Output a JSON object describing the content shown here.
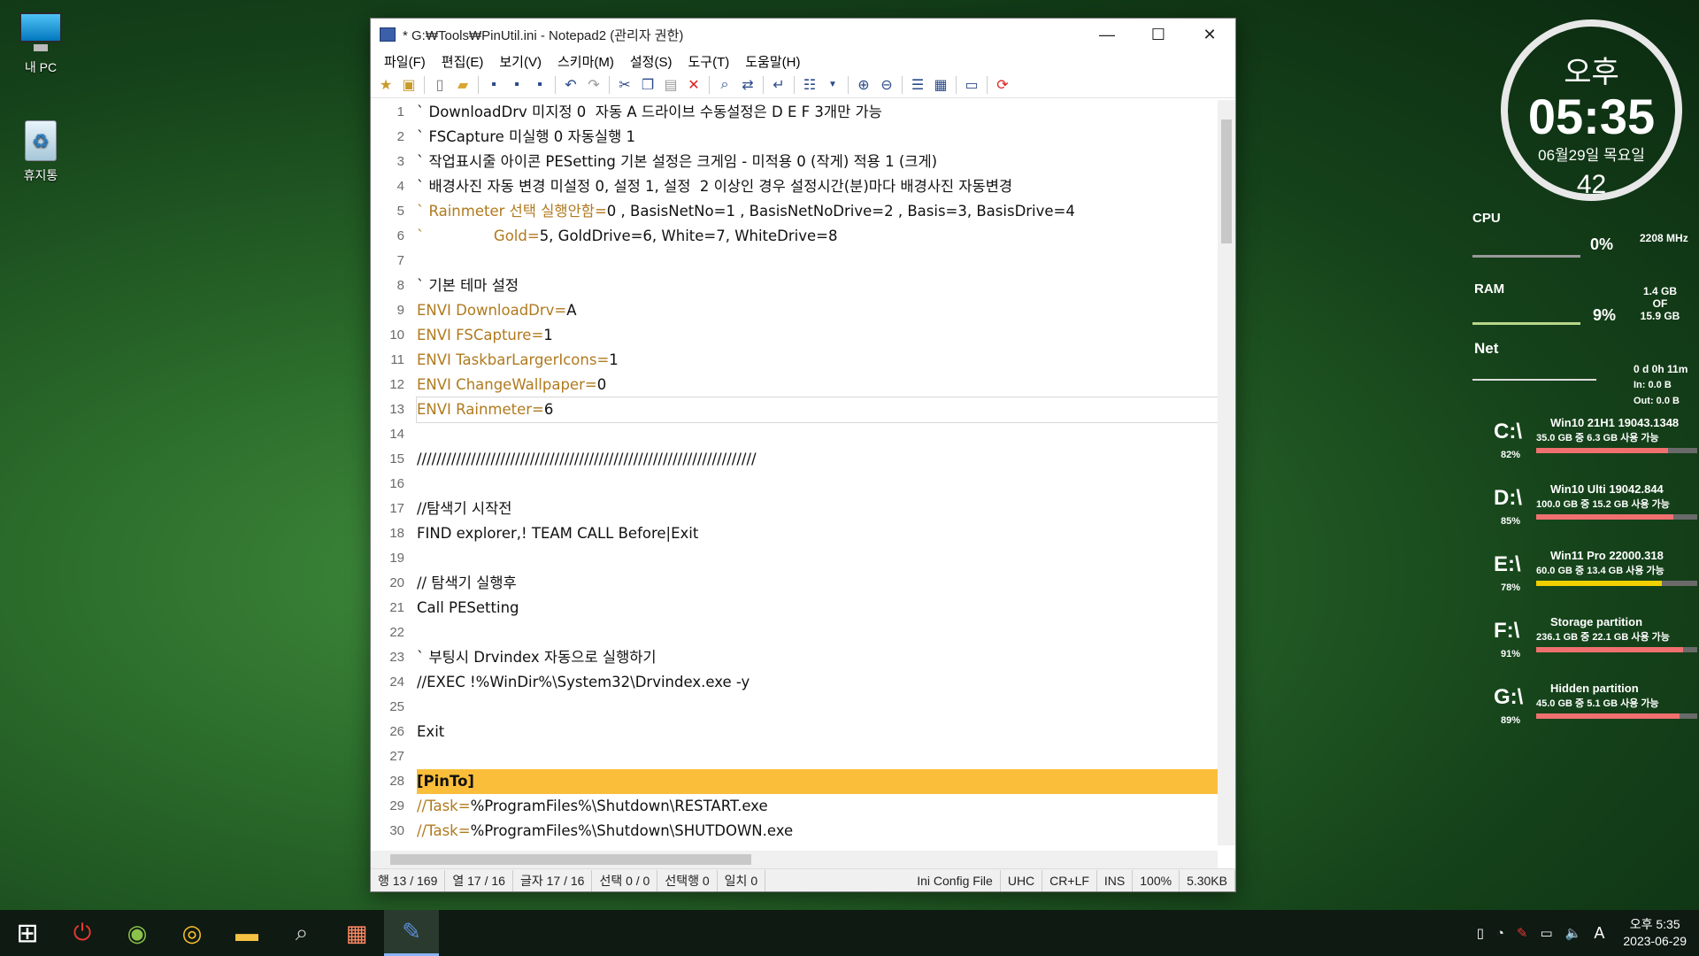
{
  "desktop": {
    "icons": [
      {
        "label": "내 PC"
      },
      {
        "label": "휴지통"
      }
    ]
  },
  "window": {
    "title": "* G:₩Tools₩PinUtil.ini - Notepad2 (관리자 권한)",
    "menu": [
      "파일(F)",
      "편집(E)",
      "보기(V)",
      "스키마(M)",
      "설정(S)",
      "도구(T)",
      "도움말(H)"
    ],
    "lines": [
      {
        "n": "1",
        "t": "` DownloadDrv 미지정 0  자동 A 드라이브 수동설정은 D E F 3개만 가능",
        "k": ""
      },
      {
        "n": "2",
        "t": "` FSCapture 미실행 0 자동실행 1",
        "k": ""
      },
      {
        "n": "3",
        "t": "` 작업표시줄 아이콘 PESetting 기본 설정은 크게임 - 미적용 0 (작게) 적용 1 (크게)",
        "k": ""
      },
      {
        "n": "4",
        "t": "` 배경사진 자동 변경 미설정 0, 설정 1, 설정  2 이상인 경우 설정시간(분)마다 배경사진 자동변경",
        "k": ""
      },
      {
        "n": "5",
        "t": "0 , BasisNetNo=1 , BasisNetNoDrive=2 , Basis=3, BasisDrive=4",
        "k": "` Rainmeter 선택 실행안함="
      },
      {
        "n": "6",
        "t": "5, GoldDrive=6, White=7, WhiteDrive=8",
        "k": "`               Gold="
      },
      {
        "n": "7",
        "t": "",
        "k": ""
      },
      {
        "n": "8",
        "t": "` 기본 테마 설정",
        "k": ""
      },
      {
        "n": "9",
        "t": "A",
        "k": "ENVI DownloadDrv="
      },
      {
        "n": "10",
        "t": "1",
        "k": "ENVI FSCapture="
      },
      {
        "n": "11",
        "t": "1",
        "k": "ENVI TaskbarLargerIcons="
      },
      {
        "n": "12",
        "t": "0",
        "k": "ENVI ChangeWallpaper="
      },
      {
        "n": "13",
        "t": "6",
        "k": "ENVI Rainmeter="
      },
      {
        "n": "14",
        "t": "",
        "k": ""
      },
      {
        "n": "15",
        "t": "/////////////////////////////////////////////////////////////////////",
        "k": ""
      },
      {
        "n": "16",
        "t": "",
        "k": ""
      },
      {
        "n": "17",
        "t": "//탐색기 시작전",
        "k": ""
      },
      {
        "n": "18",
        "t": "FIND explorer,! TEAM CALL Before|Exit",
        "k": ""
      },
      {
        "n": "19",
        "t": "",
        "k": ""
      },
      {
        "n": "20",
        "t": "// 탐색기 실행후",
        "k": ""
      },
      {
        "n": "21",
        "t": "Call PESetting",
        "k": ""
      },
      {
        "n": "22",
        "t": "",
        "k": ""
      },
      {
        "n": "23",
        "t": "` 부팅시 Drvindex 자동으로 실행하기",
        "k": ""
      },
      {
        "n": "24",
        "t": "//EXEC !%WinDir%\\System32\\Drvindex.exe -y",
        "k": ""
      },
      {
        "n": "25",
        "t": "",
        "k": ""
      },
      {
        "n": "26",
        "t": "Exit",
        "k": ""
      },
      {
        "n": "27",
        "t": "",
        "k": ""
      },
      {
        "n": "28",
        "t": "[PinTo]",
        "k": ""
      },
      {
        "n": "29",
        "t": "%ProgramFiles%\\Shutdown\\RESTART.exe",
        "k": "//Task="
      },
      {
        "n": "30",
        "t": "%ProgramFiles%\\Shutdown\\SHUTDOWN.exe",
        "k": "//Task="
      }
    ],
    "status": [
      "행 13 / 169",
      "열 17 / 16",
      "글자 17 / 16",
      "선택 0 / 0",
      "선택행 0",
      "일치 0",
      "Ini Config File",
      "UHC",
      "CR+LF",
      "INS",
      "100%",
      "5.30KB"
    ]
  },
  "clock": {
    "ampm": "오후",
    "time": "05:35",
    "date": "06월29일 목요일",
    "day": "42"
  },
  "sys": {
    "cpu_label": "CPU",
    "cpu_pct": "0%",
    "cpu_mhz": "2208 MHz",
    "ram_label": "RAM",
    "ram_pct": "9%",
    "ram_used": "1.4 GB",
    "ram_of": "OF",
    "ram_total": "15.9 GB",
    "net_label": "Net",
    "uptime": "0 d 0h 11m",
    "net_in": "In: 0.0 B",
    "net_out": "Out: 0.0 B"
  },
  "drives": [
    {
      "letter": "C:\\",
      "pct": "82%",
      "name": "Win10 21H1 19043.1348",
      "info": "35.0 GB 중   6.3 GB 사용 가능",
      "fill": 0.82,
      "color": "#f07070"
    },
    {
      "letter": "D:\\",
      "pct": "85%",
      "name": "Win10 Ulti 19042.844",
      "info": "100.0 GB 중 15.2 GB 사용 가능",
      "fill": 0.85,
      "color": "#f07070"
    },
    {
      "letter": "E:\\",
      "pct": "78%",
      "name": "Win11 Pro 22000.318",
      "info": "60.0 GB 중   13.4 GB 사용 가능",
      "fill": 0.78,
      "color": "#f0d000"
    },
    {
      "letter": "F:\\",
      "pct": "91%",
      "name": "Storage partition",
      "info": "236.1 GB 중 22.1 GB 사용 가능",
      "fill": 0.91,
      "color": "#f07070"
    },
    {
      "letter": "G:\\",
      "pct": "89%",
      "name": "Hidden partition",
      "info": "45.0 GB 중   5.1 GB 사용 가능",
      "fill": 0.89,
      "color": "#f07070"
    }
  ],
  "taskbar": {
    "time": "오후 5:35",
    "date": "2023-06-29",
    "ime": "A"
  }
}
